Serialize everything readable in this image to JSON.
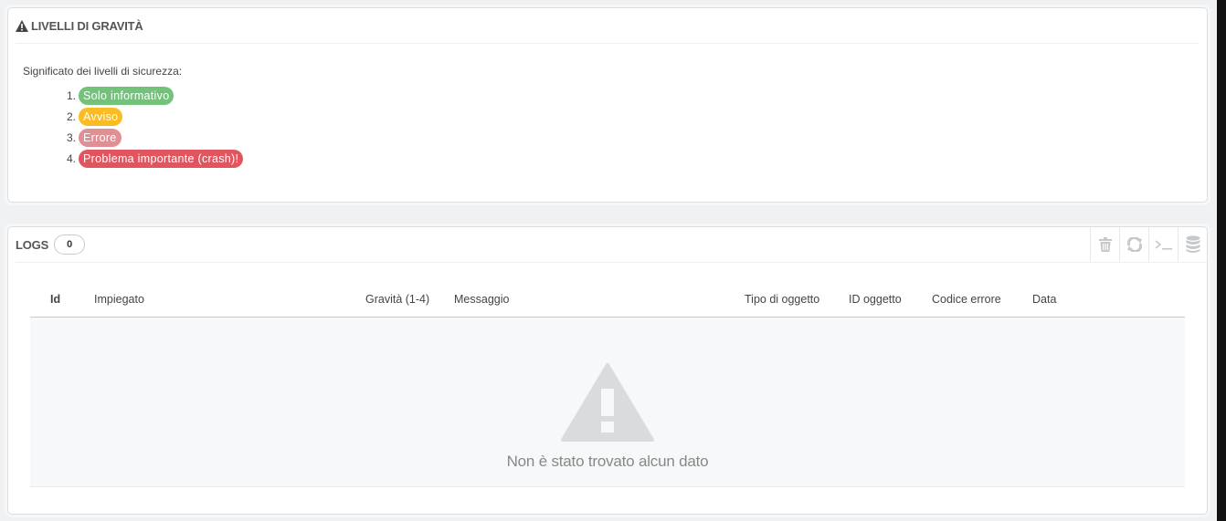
{
  "severity_panel": {
    "title": "LIVELLI DI GRAVITÀ",
    "intro": "Significato dei livelli di sicurezza:",
    "levels": [
      {
        "num": "1.",
        "label": "Solo informativo",
        "color": "#72c279"
      },
      {
        "num": "2.",
        "label": "Avviso",
        "color": "#fbbb22"
      },
      {
        "num": "3.",
        "label": "Errore",
        "color": "#e08f95"
      },
      {
        "num": "4.",
        "label": "Problema importante (crash)!",
        "color": "#e0555e"
      }
    ]
  },
  "logs_panel": {
    "title": "LOGS",
    "count": "0",
    "toolbar_icons": [
      "trash-icon",
      "refresh-icon",
      "terminal-icon",
      "database-icon"
    ],
    "columns": {
      "id": "Id",
      "employee": "Impiegato",
      "severity": "Gravità (1-4)",
      "message": "Messaggio",
      "object_type": "Tipo di oggetto",
      "object_id": "ID oggetto",
      "error_code": "Codice errore",
      "date": "Data"
    },
    "empty_message": "Non è stato trovato alcun dato"
  }
}
